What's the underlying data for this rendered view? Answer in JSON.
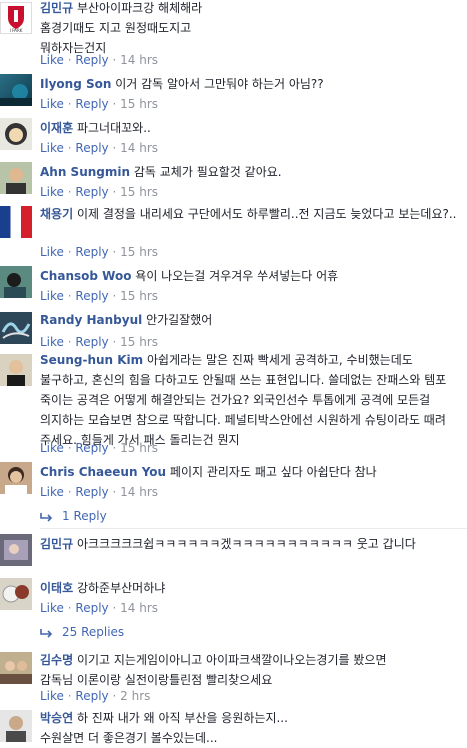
{
  "actions": {
    "like": "Like",
    "reply": "Reply",
    "sep": "·"
  },
  "comments": [
    {
      "author": "김민규",
      "text": "부산아이파크강 해체해라\n홈경기때도 지고 원정때도지고\n뭐하자는건지",
      "time": "14 hrs",
      "avatar_text": "I PARK"
    },
    {
      "author": "Ilyong Son",
      "text": "이거 감독 알아서 그만둬야 하는거 아님??",
      "time": "15 hrs"
    },
    {
      "author": "이재훈",
      "text": "파그너대꼬와..",
      "time": "14 hrs"
    },
    {
      "author": "Ahn Sungmin",
      "text": "감독 교체가 필요할것 같아요.",
      "time": "15 hrs"
    },
    {
      "author": "채용기",
      "text": "이제 결정을 내리세요 구단에서도 하루빨리..전 지금도 늦었다고 보는데요?..",
      "time": "15 hrs"
    },
    {
      "author": "Chansob Woo",
      "text": "욕이 나오는걸 겨우겨우 쑤셔넣는다 어휴",
      "time": "15 hrs"
    },
    {
      "author": "Randy Hanbyul",
      "text": "안가길잘했어",
      "time": "15 hrs"
    },
    {
      "author": "Seung-hun Kim",
      "text": "아쉽게라는 말은 진짜 빡세게 공격하고, 수비했는데도 불구하고, 혼신의 힘을 다하고도 안될때 쓰는 표현입니다. 쓸데없는 잔패스와 템포 죽이는 공격은 어떻게 해결안되는 건가요? 외국인선수 투톱에게 공격에 모든걸 의지하는 모습보면 참으로 딱합니다. 페널티박스안에선 시원하게 슈팅이라도 때려 주세요. 힘들게 가서 패스 돌리는건 뭔지",
      "time": "15 hrs"
    },
    {
      "author": "Chris Chaeeun You",
      "text": "페이지 관리자도 패고 싶다 아쉽단다 참나",
      "time": "14 hrs",
      "replies": "1 Reply"
    },
    {
      "author": "김민규",
      "text": "아크크크크크쉽ㅋㅋㅋㅋㅋㅋ겠ㅋㅋㅋㅋㅋㅋㅋㅋㅋㅋㅋ 웃고 갑니다",
      "time": ""
    },
    {
      "author": "이태호",
      "text": "강하준부산머하냐",
      "time": "14 hrs",
      "replies": "25 Replies"
    },
    {
      "author": "김수명",
      "text": "이기고 지는게임이아니고 아이파크색깔이나오는경기를 봤으면\n감독님 이론이랑 실전이랑틀린점 빨리찾으세요",
      "time": "2 hrs"
    },
    {
      "author": "박승연",
      "text": "하 진짜 내가 왜 아직 부산을 응원하는지...\n수원살면 더 좋은경기 볼수있는데...",
      "time": ""
    }
  ]
}
